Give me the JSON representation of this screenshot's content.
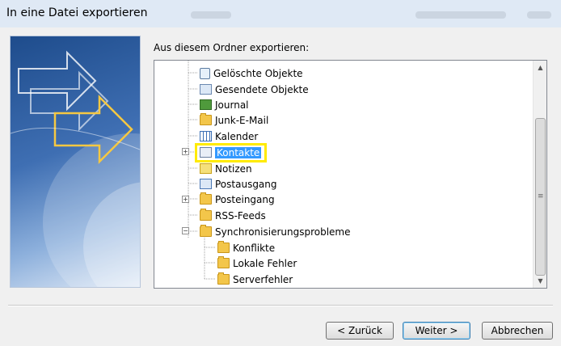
{
  "window": {
    "title": "In eine Datei exportieren"
  },
  "prompt": "Aus diesem Ordner exportieren:",
  "tree": {
    "items": [
      {
        "label": "Gelöschte Objekte",
        "icon": "deleted-items-icon"
      },
      {
        "label": "Gesendete Objekte",
        "icon": "sent-items-icon"
      },
      {
        "label": "Journal",
        "icon": "journal-icon"
      },
      {
        "label": "Junk-E-Mail",
        "icon": "folder-icon"
      },
      {
        "label": "Kalender",
        "icon": "calendar-icon"
      },
      {
        "label": "Kontakte",
        "icon": "contacts-icon",
        "selected": true,
        "expandable": true
      },
      {
        "label": "Notizen",
        "icon": "notes-icon"
      },
      {
        "label": "Postausgang",
        "icon": "outbox-icon"
      },
      {
        "label": "Posteingang",
        "icon": "inbox-icon",
        "expandable": true
      },
      {
        "label": "RSS-Feeds",
        "icon": "folder-icon"
      },
      {
        "label": "Synchronisierungsprobleme",
        "icon": "folder-icon",
        "expanded": true
      },
      {
        "label": "Konflikte",
        "icon": "folder-icon"
      },
      {
        "label": "Lokale Fehler",
        "icon": "folder-icon"
      },
      {
        "label": "Serverfehler",
        "icon": "folder-icon"
      }
    ]
  },
  "buttons": {
    "back": "< Zurück",
    "next": "Weiter >",
    "cancel": "Abbrechen"
  },
  "colors": {
    "selection": "#3399ff",
    "highlight_box": "#ffeb00"
  }
}
